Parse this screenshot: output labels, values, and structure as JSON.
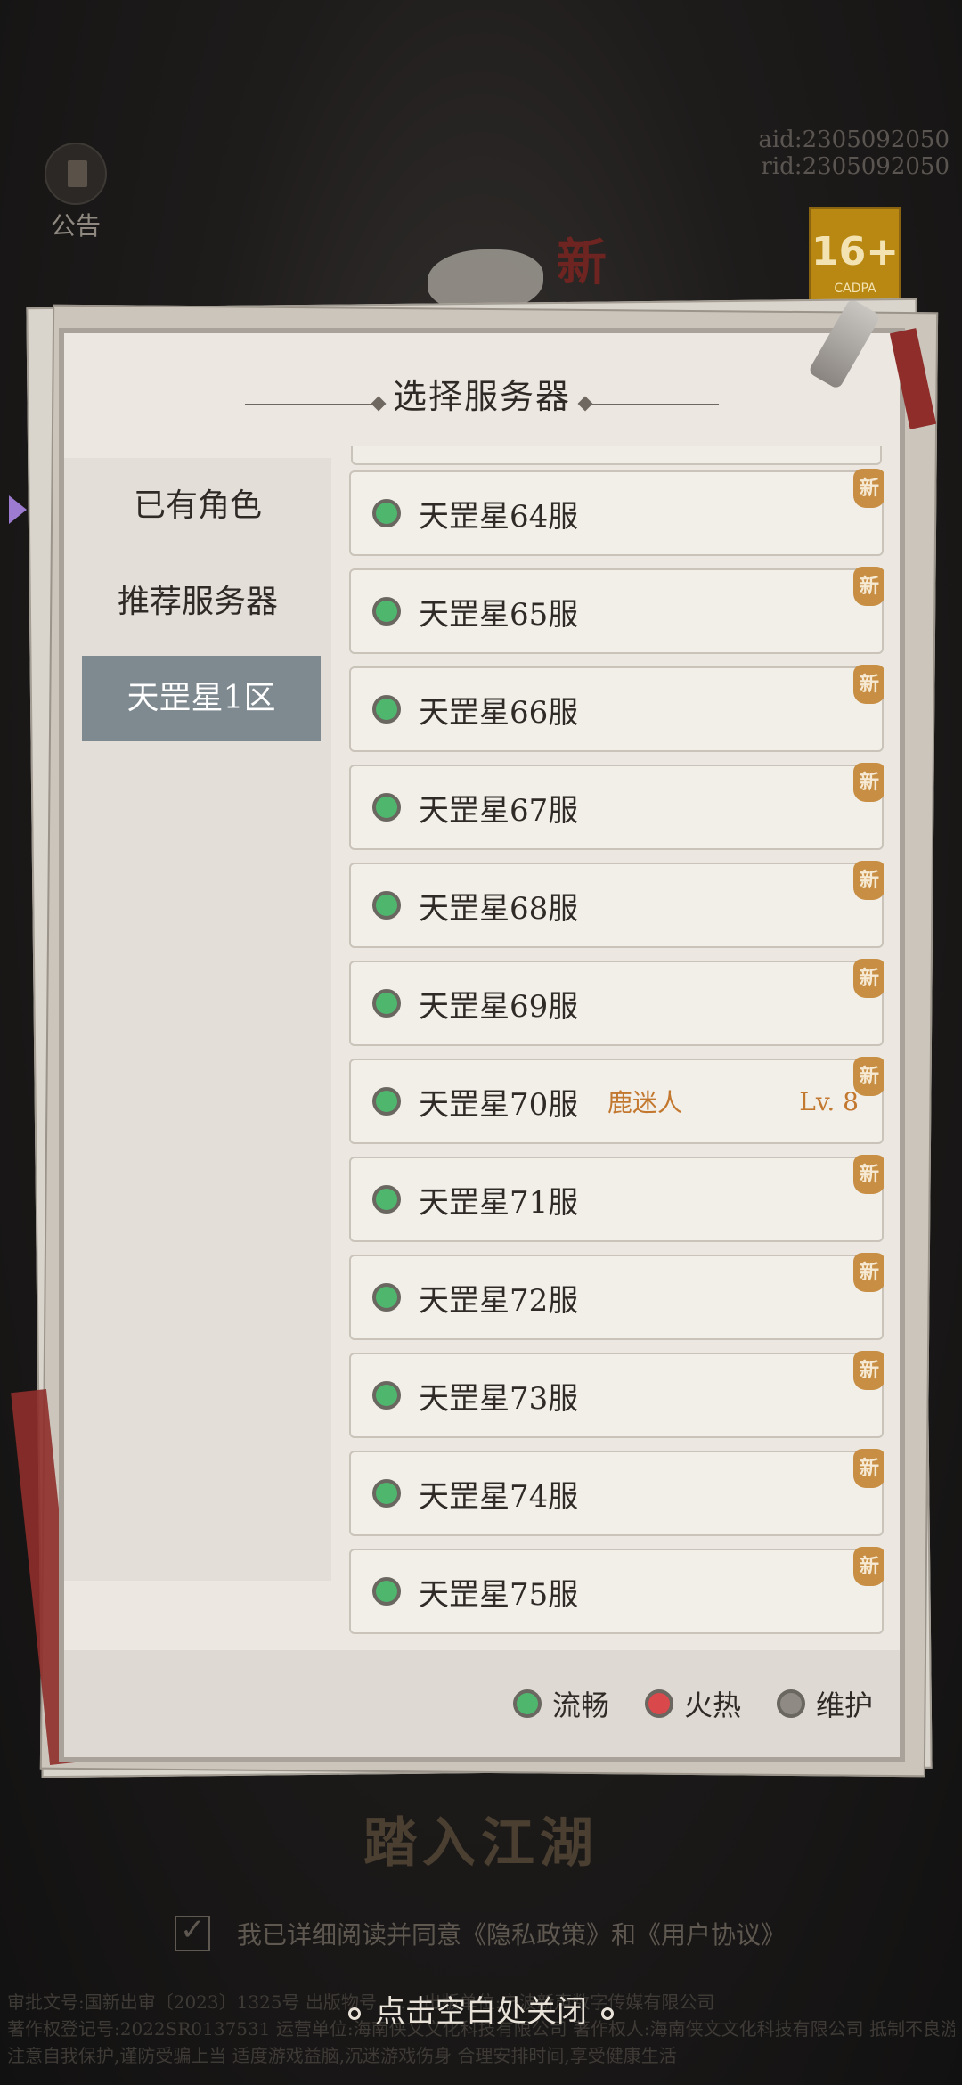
{
  "background": {
    "aid": "aid:2305092050",
    "rid": "rid:2305092050",
    "notice_label": "公告",
    "age_rating": "16+",
    "age_org": "CADPA",
    "seal_char": "新",
    "enter_title": "踏入江湖",
    "agreement_text": "我已详细阅读并同意《隐私政策》和《用户协议》",
    "close_hint": "点击空白处关闭",
    "footer_lines": [
      "审批文号:国新出审〔2023〕1325号 出版物号 …… 出版单位:宁波新声数字传媒有限公司",
      "著作权登记号:2022SR0137531 运营单位:海南侠文文化科技有限公司 著作权人:海南侠文文化科技有限公司 抵制不良游戏,拒绝盗版游戏",
      "注意自我保护,谨防受骗上当 适度游戏益脑,沉迷游戏伤身 合理安排时间,享受健康生活"
    ]
  },
  "panel": {
    "title": "选择服务器",
    "sidebar": [
      {
        "label": "已有角色",
        "active": false
      },
      {
        "label": "推荐服务器",
        "active": false
      },
      {
        "label": "天罡星1区",
        "active": true
      }
    ],
    "new_tag": "新",
    "servers": [
      {
        "name": "天罡星64服",
        "status": "流畅",
        "new": true,
        "character": "",
        "level": ""
      },
      {
        "name": "天罡星65服",
        "status": "流畅",
        "new": true,
        "character": "",
        "level": ""
      },
      {
        "name": "天罡星66服",
        "status": "流畅",
        "new": true,
        "character": "",
        "level": ""
      },
      {
        "name": "天罡星67服",
        "status": "流畅",
        "new": true,
        "character": "",
        "level": ""
      },
      {
        "name": "天罡星68服",
        "status": "流畅",
        "new": true,
        "character": "",
        "level": ""
      },
      {
        "name": "天罡星69服",
        "status": "流畅",
        "new": true,
        "character": "",
        "level": ""
      },
      {
        "name": "天罡星70服",
        "status": "流畅",
        "new": true,
        "character": "鹿迷人",
        "level": "Lv. 8"
      },
      {
        "name": "天罡星71服",
        "status": "流畅",
        "new": true,
        "character": "",
        "level": ""
      },
      {
        "name": "天罡星72服",
        "status": "流畅",
        "new": true,
        "character": "",
        "level": ""
      },
      {
        "name": "天罡星73服",
        "status": "流畅",
        "new": true,
        "character": "",
        "level": ""
      },
      {
        "name": "天罡星74服",
        "status": "流畅",
        "new": true,
        "character": "",
        "level": ""
      },
      {
        "name": "天罡星75服",
        "status": "流畅",
        "new": true,
        "character": "",
        "level": ""
      }
    ],
    "legend": [
      {
        "label": "流畅",
        "color": "#4fb66e"
      },
      {
        "label": "火热",
        "color": "#d9484b"
      },
      {
        "label": "维护",
        "color": "#8f8a84"
      }
    ]
  },
  "colors": {
    "smooth": "#4fb66e",
    "hot": "#d9484b",
    "maintenance": "#8f8a84",
    "active_tab": "#7e8990",
    "character_text": "#c3782f"
  }
}
